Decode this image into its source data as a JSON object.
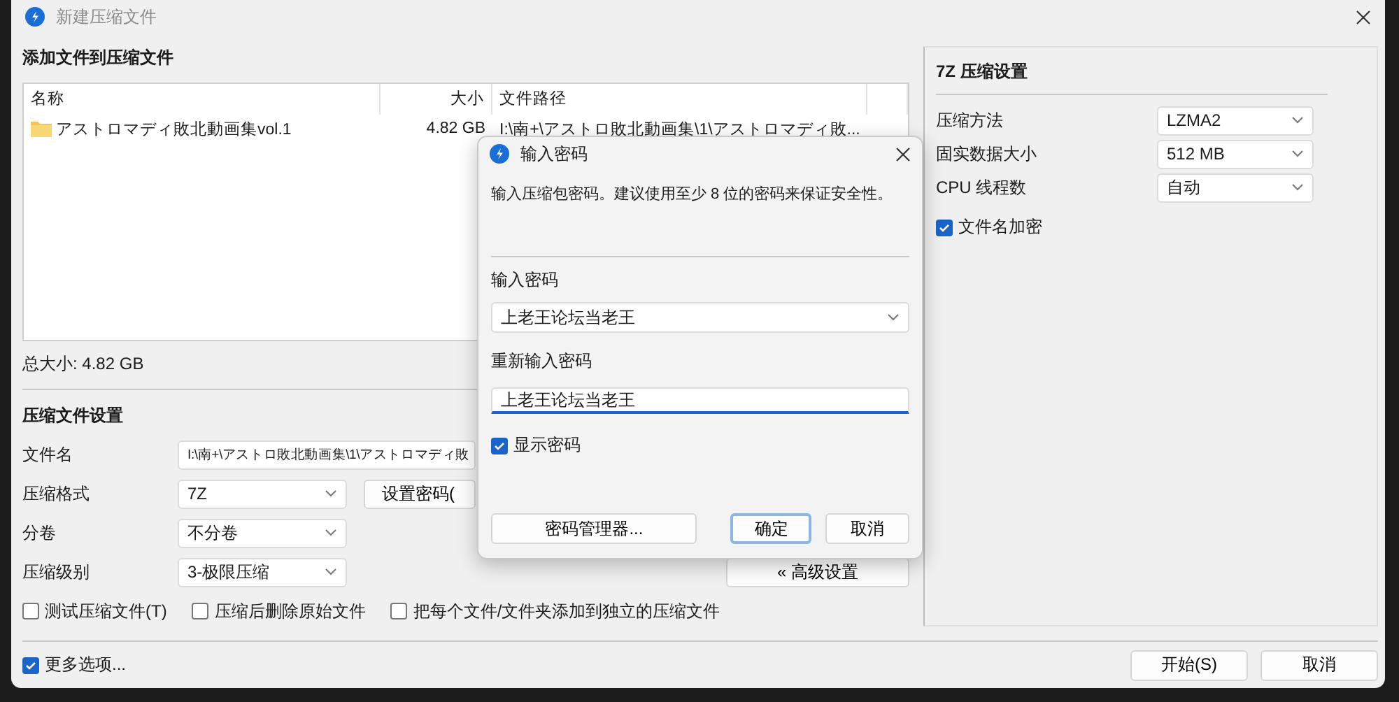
{
  "window": {
    "title": "新建压缩文件"
  },
  "files": {
    "title": "添加文件到压缩文件",
    "columns": [
      "名称",
      "大小",
      "文件路径"
    ],
    "rows": [
      {
        "name": "アストロマディ敗北動画集vol.1",
        "size": "4.82 GB",
        "path": "I:\\南+\\アストロ敗北動画集\\1\\アストロマディ敗..."
      }
    ],
    "total": "总大小: 4.82 GB"
  },
  "settings": {
    "title": "压缩文件设置",
    "fields": [
      {
        "kind": "text",
        "label": "文件名",
        "value": "I:\\南+\\アストロ敗北動画集\\1\\アストロマディ敗"
      },
      {
        "kind": "select",
        "label": "压缩格式",
        "value": "7Z"
      },
      {
        "kind": "select",
        "label": "分卷",
        "value": "不分卷"
      },
      {
        "kind": "select",
        "label": "压缩级别",
        "value": "3-极限压缩"
      }
    ],
    "password_button": "设置密码(",
    "advanced_button": "« 高级设置",
    "options": [
      {
        "label": "测试压缩文件(T)",
        "checked": false
      },
      {
        "label": "压缩后删除原始文件",
        "checked": false
      },
      {
        "label": "把每个文件/文件夹添加到独立的压缩文件",
        "checked": false
      }
    ]
  },
  "format_panel": {
    "title": "7Z 压缩设置",
    "fields": [
      {
        "label": "压缩方法",
        "value": "LZMA2"
      },
      {
        "label": "固实数据大小",
        "value": "512 MB"
      },
      {
        "label": "CPU 线程数",
        "value": "自动"
      }
    ],
    "options": [
      {
        "label": "文件名加密",
        "checked": true
      }
    ]
  },
  "more_options": {
    "label": "更多选项...",
    "checked": true
  },
  "buttons": [
    "开始(S)",
    "取消"
  ],
  "password_dialog": {
    "title": "输入密码",
    "hint": "输入压缩包密码。建议使用至少 8 位的密码来保证安全性。",
    "password_label": "输入密码",
    "password": "上老王论坛当老王",
    "confirm_label": "重新输入密码",
    "confirm": "上老王论坛当老王",
    "show_password": {
      "label": "显示密码",
      "checked": true
    },
    "buttons": [
      {
        "label": "密码管理器...",
        "default": false
      },
      {
        "label": "确定",
        "default": true
      },
      {
        "label": "取消",
        "default": false
      }
    ]
  }
}
